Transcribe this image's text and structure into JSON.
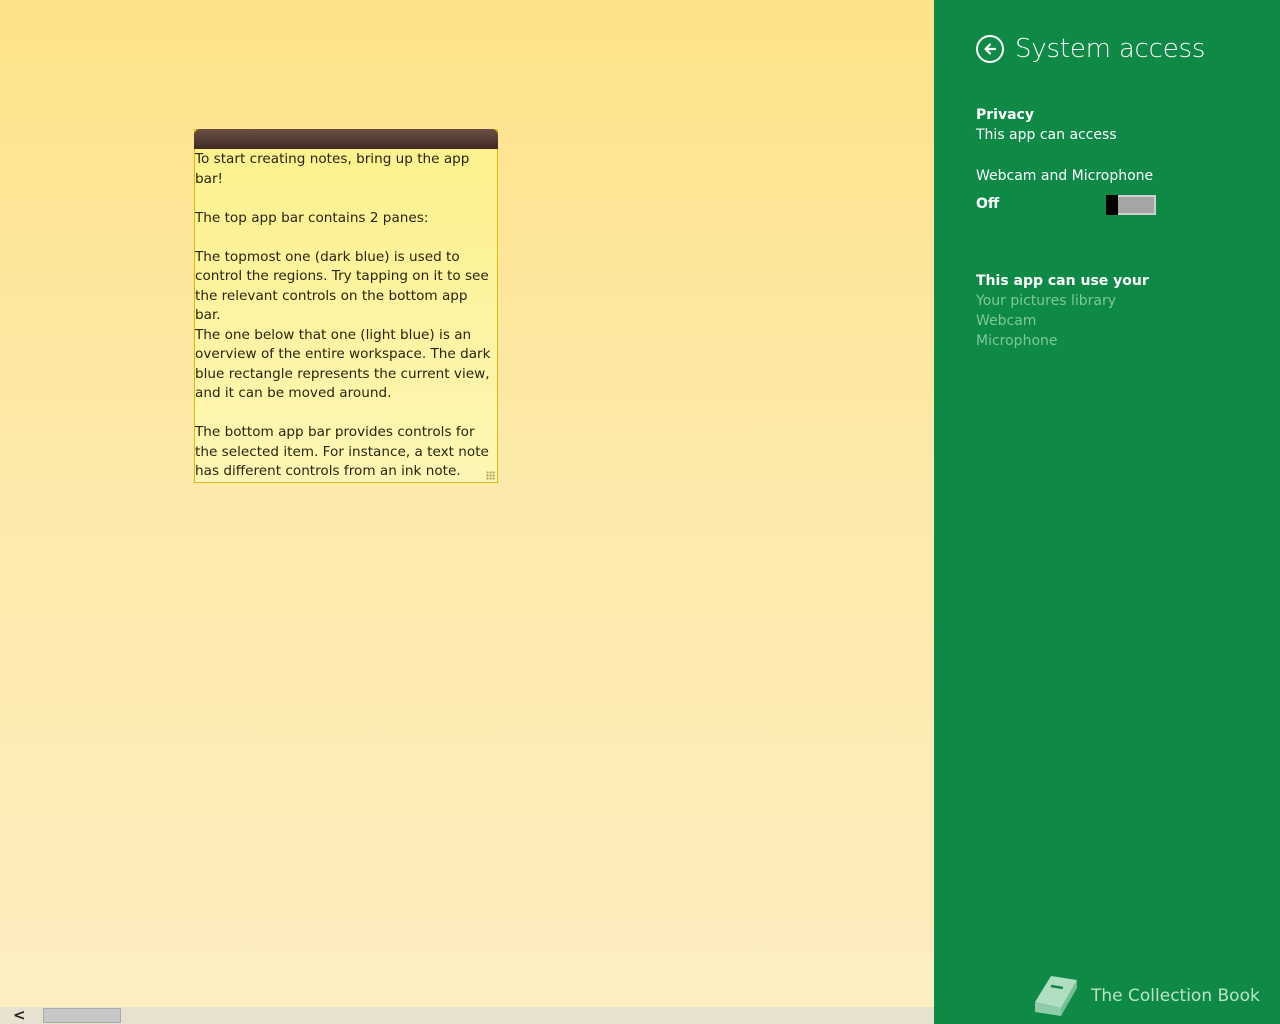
{
  "workspace": {
    "note": {
      "text": "To start creating notes, bring up the app\nbar!\n\nThe top app bar contains 2 panes:\n\nThe topmost one (dark blue) is used to\ncontrol the regions. Try tapping on it to see\nthe relevant controls on the bottom app bar.\nThe one below that one (light blue) is an\noverview of the entire workspace. The dark\nblue rectangle represents the current view,\nand it can be moved around.\n\nThe bottom app bar provides controls for\nthe selected item. For instance, a text note\nhas different controls from an ink note."
    },
    "scrollbar": {
      "left_arrow": "<"
    }
  },
  "settings_pane": {
    "title": "System access",
    "privacy": {
      "heading": "Privacy",
      "subtitle": "This app can access"
    },
    "webcam_mic": {
      "label": "Webcam and Microphone",
      "state": "Off"
    },
    "capabilities": {
      "heading": "This app can use your",
      "items": [
        "Your pictures library",
        "Webcam",
        "Microphone"
      ]
    },
    "brand": {
      "name": "The Collection Book"
    }
  }
}
